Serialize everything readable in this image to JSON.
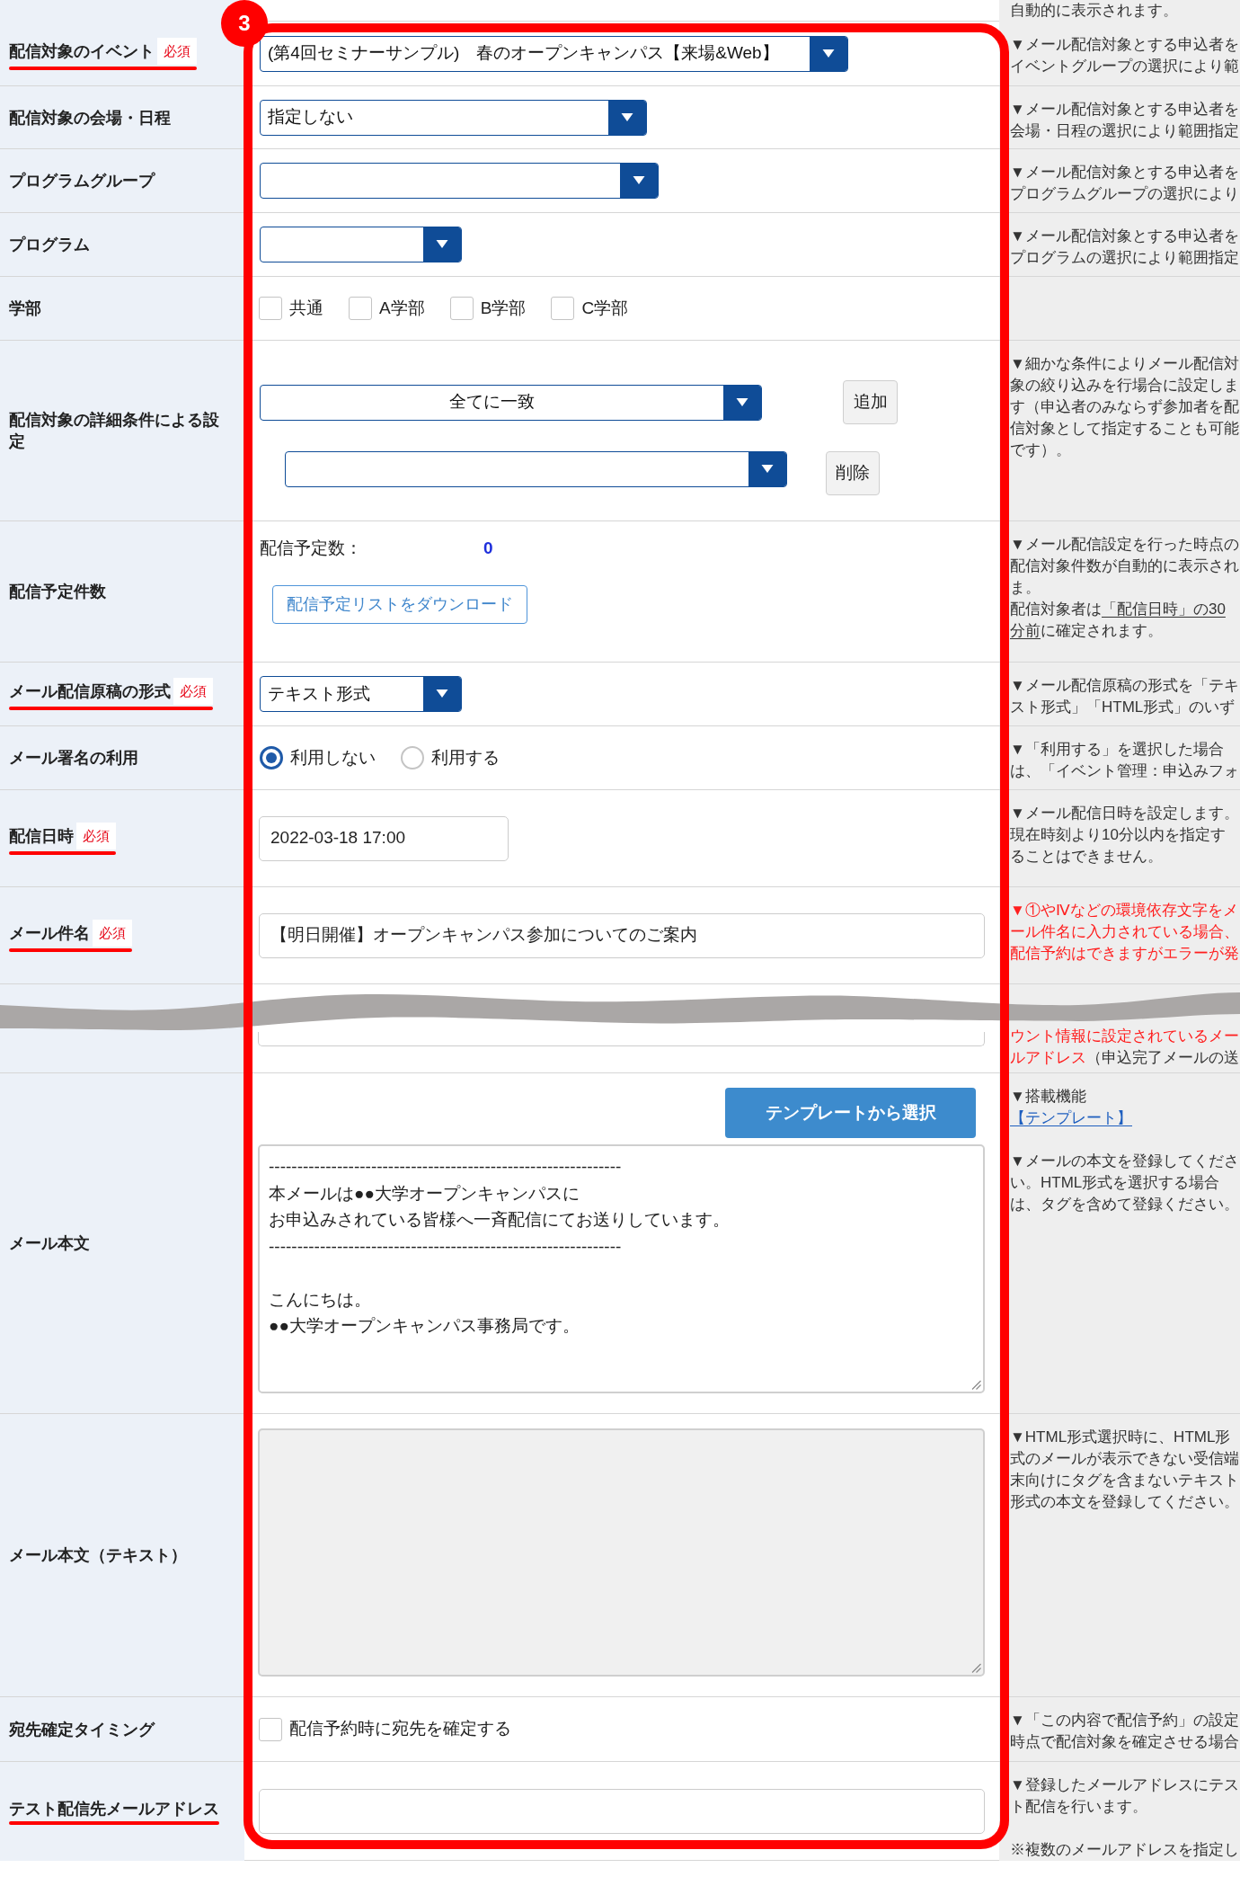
{
  "annotation": {
    "step": "3"
  },
  "top_row": {
    "note": [
      {
        "parts": [
          {
            "kind": "plain",
            "text": "自動的に表示されます。"
          }
        ]
      }
    ]
  },
  "rows": [
    {
      "kind": "select",
      "label": "配信対象のイベント",
      "badge": "必須",
      "underlined": true,
      "value": "(第4回セミナーサンプル)　春のオープンキャンパス【来場&Web】",
      "note": [
        {
          "parts": [
            {
              "kind": "plain",
              "text": "▼メール配信対象とする申込者をイベントグループの選択により範"
            }
          ]
        }
      ]
    },
    {
      "kind": "select",
      "label": "配信対象の会場・日程",
      "underlined": false,
      "value": "指定しない",
      "note": [
        {
          "parts": [
            {
              "kind": "plain",
              "text": "▼メール配信対象とする申込者を会場・日程の選択により範囲指定"
            }
          ]
        }
      ]
    },
    {
      "kind": "select",
      "label": "プログラムグループ",
      "underlined": false,
      "note": [
        {
          "parts": [
            {
              "kind": "plain",
              "text": "▼メール配信対象とする申込者をプログラムグループの選択により"
            }
          ]
        }
      ]
    },
    {
      "kind": "select",
      "label": "プログラム",
      "underlined": false,
      "note": [
        {
          "parts": [
            {
              "kind": "plain",
              "text": "▼メール配信対象とする申込者をプログラムの選択により範囲指定"
            }
          ]
        }
      ]
    },
    {
      "kind": "checkboxes",
      "label": "学部",
      "underlined": false,
      "options": [
        {
          "label": "共通",
          "checked": false
        },
        {
          "label": "A学部",
          "checked": false
        },
        {
          "label": "B学部",
          "checked": false
        },
        {
          "label": "C学部",
          "checked": false
        }
      ]
    },
    {
      "kind": "conditions",
      "label": "配信対象の詳細条件による設定",
      "underlined": false,
      "lines": [
        {
          "value": "全てに一致",
          "button": "追加"
        },
        {
          "button": "削除"
        }
      ],
      "note": [
        {
          "parts": [
            {
              "kind": "plain",
              "text": "▼細かな条件によりメール配信対象の絞り込みを行場合に設定します（申込者のみならず参加者を配信対象として指定することも可能です）。"
            }
          ]
        }
      ]
    },
    {
      "kind": "count",
      "label": "配信予定件数",
      "underlined": false,
      "count_label": "配信予定数：",
      "count": "0",
      "button": "配信予定リストをダウンロード",
      "note": [
        {
          "parts": [
            {
              "kind": "plain",
              "text": "▼メール配信設定を行った時点の配信対象件数が自動的に表示されま。"
            }
          ]
        },
        {
          "parts": [
            {
              "kind": "plain",
              "text": "配信対象者は"
            },
            {
              "kind": "underline",
              "text": "「配信日時」の30分前"
            },
            {
              "kind": "plain",
              "text": "に確定されます。"
            }
          ]
        }
      ]
    },
    {
      "kind": "select",
      "label": "メール配信原稿の形式",
      "badge": "必須",
      "underlined": true,
      "value": "テキスト形式",
      "note": [
        {
          "parts": [
            {
              "kind": "plain",
              "text": "▼メール配信原稿の形式を「テキスト形式」「HTML形式」のいず"
            }
          ]
        }
      ]
    },
    {
      "kind": "radios",
      "label": "メール署名の利用",
      "underlined": false,
      "options": [
        {
          "label": "利用しない",
          "selected": true
        },
        {
          "label": "利用する",
          "selected": false
        }
      ],
      "note": [
        {
          "parts": [
            {
              "kind": "plain",
              "text": "▼「利用する」を選択した場合は、「イベント管理：申込みフォ"
            }
          ]
        }
      ]
    },
    {
      "kind": "input",
      "label": "配信日時",
      "badge": "必須",
      "underlined": true,
      "value": "2022-03-18 17:00",
      "note": [
        {
          "parts": [
            {
              "kind": "plain",
              "text": "▼メール配信日時を設定します。現在時刻より10分以内を指定することはできません。"
            }
          ]
        }
      ]
    },
    {
      "kind": "input",
      "label": "メール件名",
      "badge": "必須",
      "underlined": true,
      "value": "【明日開催】オープンキャンパス参加についてのご案内",
      "note": [
        {
          "parts": [
            {
              "kind": "alert",
              "text": "▼①やⅣなどの環境依存文字をメール件名に入力されている場合、配信予約はできますがエラーが発"
            }
          ]
        }
      ]
    },
    {
      "kind": "input",
      "underlined": false,
      "note": [
        {
          "parts": [
            {
              "kind": "alert",
              "text": "ウント情報に設定されているメールアドレス"
            },
            {
              "kind": "plain",
              "text": "（申込完了メールの送"
            }
          ]
        }
      ]
    },
    {
      "kind": "textarea",
      "label": "メール本文",
      "underlined": false,
      "button": "テンプレートから選択",
      "disabled": false,
      "paragraphs": [
        {
          "lines": [
            "--------------------------------------------------------------",
            "本メールは●●大学オープンキャンパスに",
            "お申込みされている皆様へ一斉配信にてお送りしています。",
            "--------------------------------------------------------------"
          ]
        },
        {
          "lines": [
            "こんにちは。",
            "●●大学オープンキャンパス事務局です。"
          ]
        }
      ],
      "note": [
        {
          "parts": [
            {
              "kind": "plain",
              "text": "▼搭載機能"
            },
            {
              "kind": "link",
              "text": "【テンプレート】"
            }
          ]
        },
        {
          "parts": [
            {
              "kind": "plain",
              "text": "▼メールの本文を登録してください。HTML形式を選択する場合は、タグを含めて登録ください。"
            }
          ]
        }
      ]
    },
    {
      "kind": "textarea",
      "label": "メール本文（テキスト）",
      "underlined": false,
      "disabled": true,
      "note": [
        {
          "parts": [
            {
              "kind": "plain",
              "text": "▼HTML形式選択時に、HTML形式のメールが表示できない受信端末向けにタグを含まないテキスト形式の本文を登録してください。"
            }
          ]
        }
      ]
    },
    {
      "kind": "checkboxes",
      "label": "宛先確定タイミング",
      "underlined": false,
      "options": [
        {
          "label": "配信予約時に宛先を確定する",
          "checked": false
        }
      ],
      "note": [
        {
          "parts": [
            {
              "kind": "plain",
              "text": "▼「この内容で配信予約」の設定時点で配信対象を確定させる場合"
            }
          ]
        }
      ]
    },
    {
      "kind": "input",
      "label": "テスト配信先メールアドレス",
      "underlined": true,
      "note": [
        {
          "parts": [
            {
              "kind": "plain",
              "text": "▼登録したメールアドレスにテスト配信を行います。"
            }
          ]
        },
        {
          "parts": [
            {
              "kind": "plain",
              "text": "※複数のメールアドレスを指定し"
            }
          ]
        }
      ]
    }
  ]
}
